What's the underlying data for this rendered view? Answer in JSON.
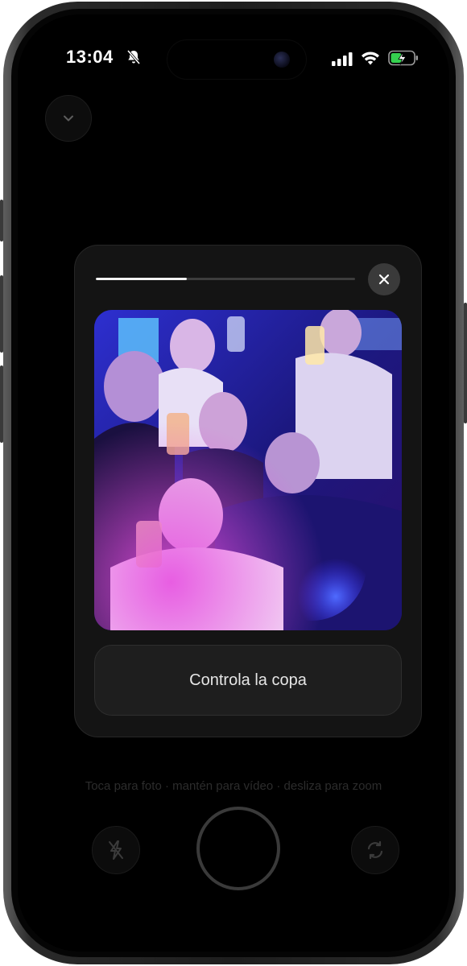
{
  "status_bar": {
    "time": "13:04",
    "icons": [
      "bell-slash-icon",
      "cellular-signal-icon",
      "wifi-icon",
      "battery-charging-icon"
    ]
  },
  "header": {
    "collapse_icon": "chevron-down-icon"
  },
  "story_card": {
    "progress": 0.35,
    "close_icon": "close-icon",
    "photo": {
      "description_icon": "photo-party-group",
      "tint_colors": [
        "#2a1fb8",
        "#c23ad6",
        "#6a4cff"
      ]
    },
    "action_label": "Controla la copa"
  },
  "camera": {
    "hint": "Toca para foto · mantén para vídeo · desliza para zoom",
    "flash_icon": "flash-off-icon",
    "flip_icon": "camera-flip-icon"
  },
  "colors": {
    "background": "#000000",
    "card": "#141414",
    "progress_fill": "#f2f2f2",
    "progress_track": "#3d3d3d"
  }
}
